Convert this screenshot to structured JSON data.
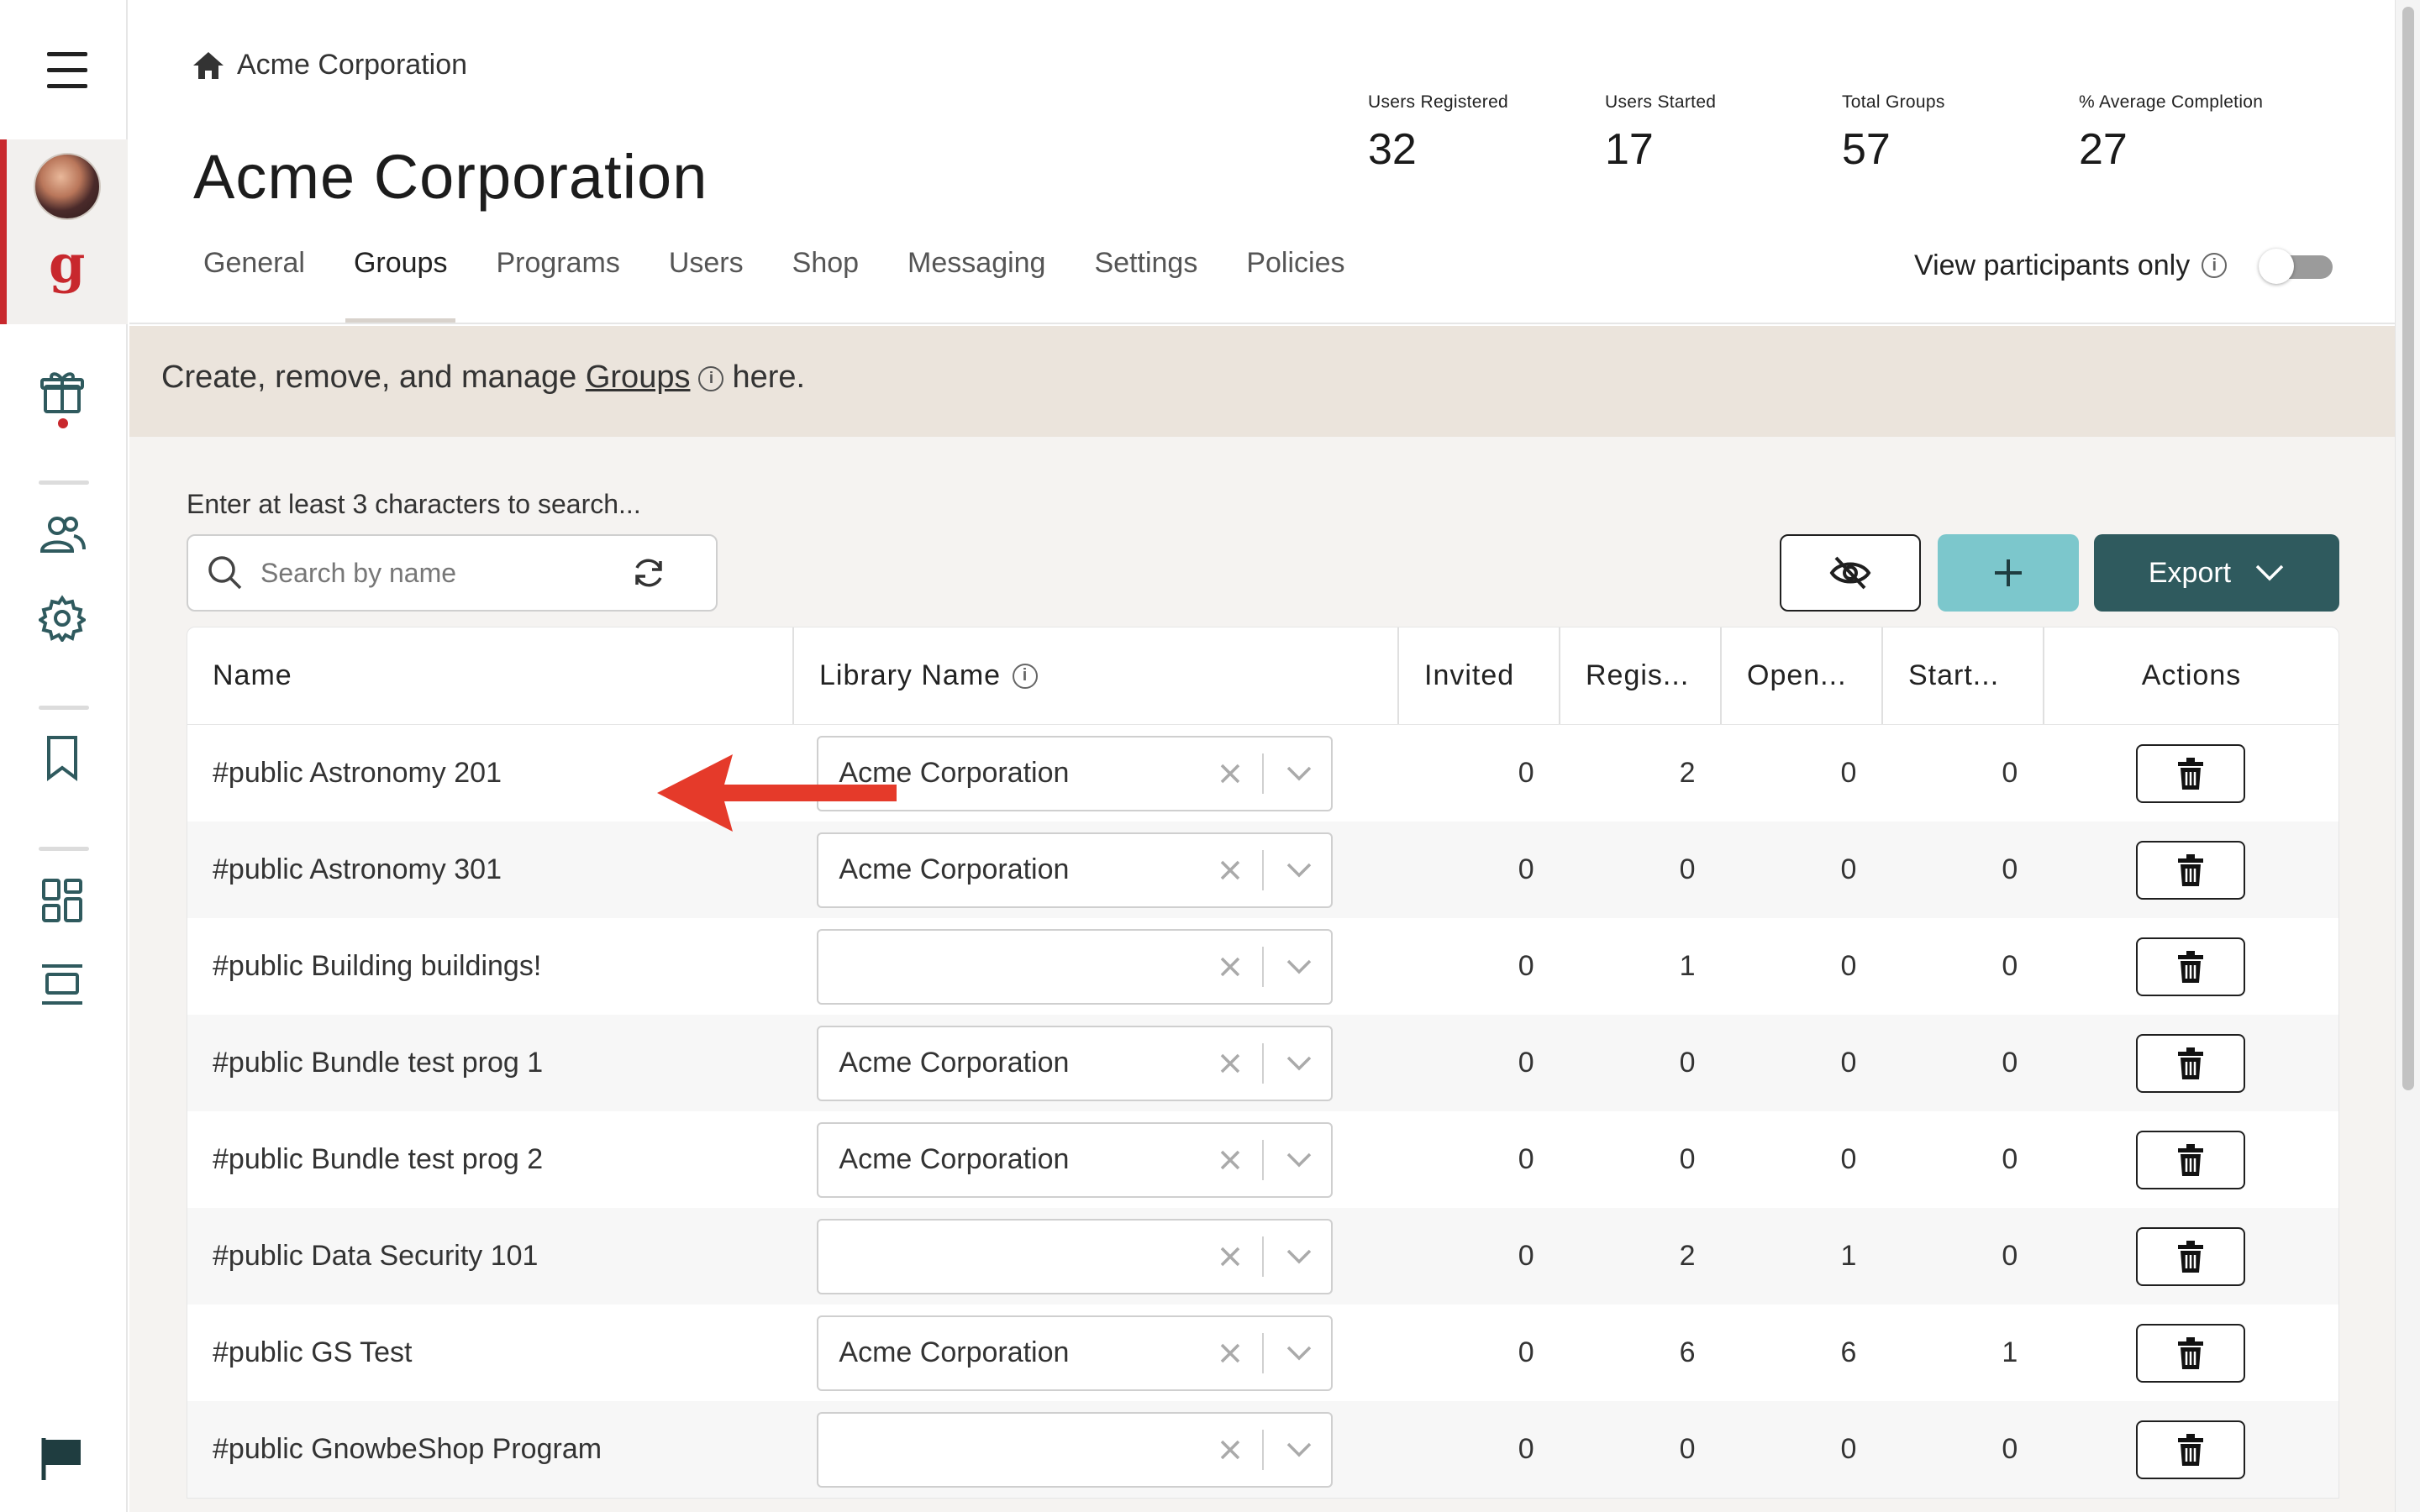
{
  "sidebar": {
    "menu_icon": "hamburger-menu-icon",
    "logo_letter": "g",
    "icons": [
      "gift-icon",
      "users-icon",
      "gear-icon",
      "bookmark-icon",
      "dashboard-grid-icon",
      "layout-icon",
      "flag-icon"
    ],
    "active_color": "#c8282d"
  },
  "header": {
    "breadcrumb": "Acme Corporation",
    "title": "Acme Corporation",
    "stats": [
      {
        "label": "Users Registered",
        "value": "32"
      },
      {
        "label": "Users Started",
        "value": "17"
      },
      {
        "label": "Total Groups",
        "value": "57"
      },
      {
        "label": "% Average Completion",
        "value": "27"
      }
    ],
    "tabs": [
      "General",
      "Groups",
      "Programs",
      "Users",
      "Shop",
      "Messaging",
      "Settings",
      "Policies"
    ],
    "active_tab": "Groups",
    "view_participants_label": "View participants only",
    "view_participants_on": false
  },
  "banner": {
    "prefix": "Create, remove, and manage",
    "link": "Groups",
    "suffix": "here.",
    "background": "#ebe4dc"
  },
  "search": {
    "hint": "Enter at least 3 characters to search...",
    "placeholder": "Search by name",
    "value": ""
  },
  "toolbar": {
    "export_label": "Export",
    "add_color": "#7cc7cc",
    "export_color": "#2f5a5e"
  },
  "table": {
    "columns": [
      "Name",
      "Library Name",
      "Invited",
      "Regis...",
      "Open...",
      "Start...",
      "Actions"
    ],
    "rows": [
      {
        "name": "#public Astronomy 201",
        "library": "Acme Corporation",
        "invited": "0",
        "registered": "2",
        "opened": "0",
        "started": "0"
      },
      {
        "name": "#public Astronomy 301",
        "library": "Acme Corporation",
        "invited": "0",
        "registered": "0",
        "opened": "0",
        "started": "0"
      },
      {
        "name": "#public Building buildings!",
        "library": "",
        "invited": "0",
        "registered": "1",
        "opened": "0",
        "started": "0"
      },
      {
        "name": "#public Bundle test prog 1",
        "library": "Acme Corporation",
        "invited": "0",
        "registered": "0",
        "opened": "0",
        "started": "0"
      },
      {
        "name": "#public Bundle test prog 2",
        "library": "Acme Corporation",
        "invited": "0",
        "registered": "0",
        "opened": "0",
        "started": "0"
      },
      {
        "name": "#public Data Security 101",
        "library": "",
        "invited": "0",
        "registered": "2",
        "opened": "1",
        "started": "0"
      },
      {
        "name": "#public GS Test",
        "library": "Acme Corporation",
        "invited": "0",
        "registered": "6",
        "opened": "6",
        "started": "1"
      },
      {
        "name": "#public GnowbeShop Program",
        "library": "",
        "invited": "0",
        "registered": "0",
        "opened": "0",
        "started": "0"
      }
    ]
  },
  "annotation": {
    "arrow_icon": "red-arrow-left-icon",
    "arrow_color": "#e53a2a"
  }
}
